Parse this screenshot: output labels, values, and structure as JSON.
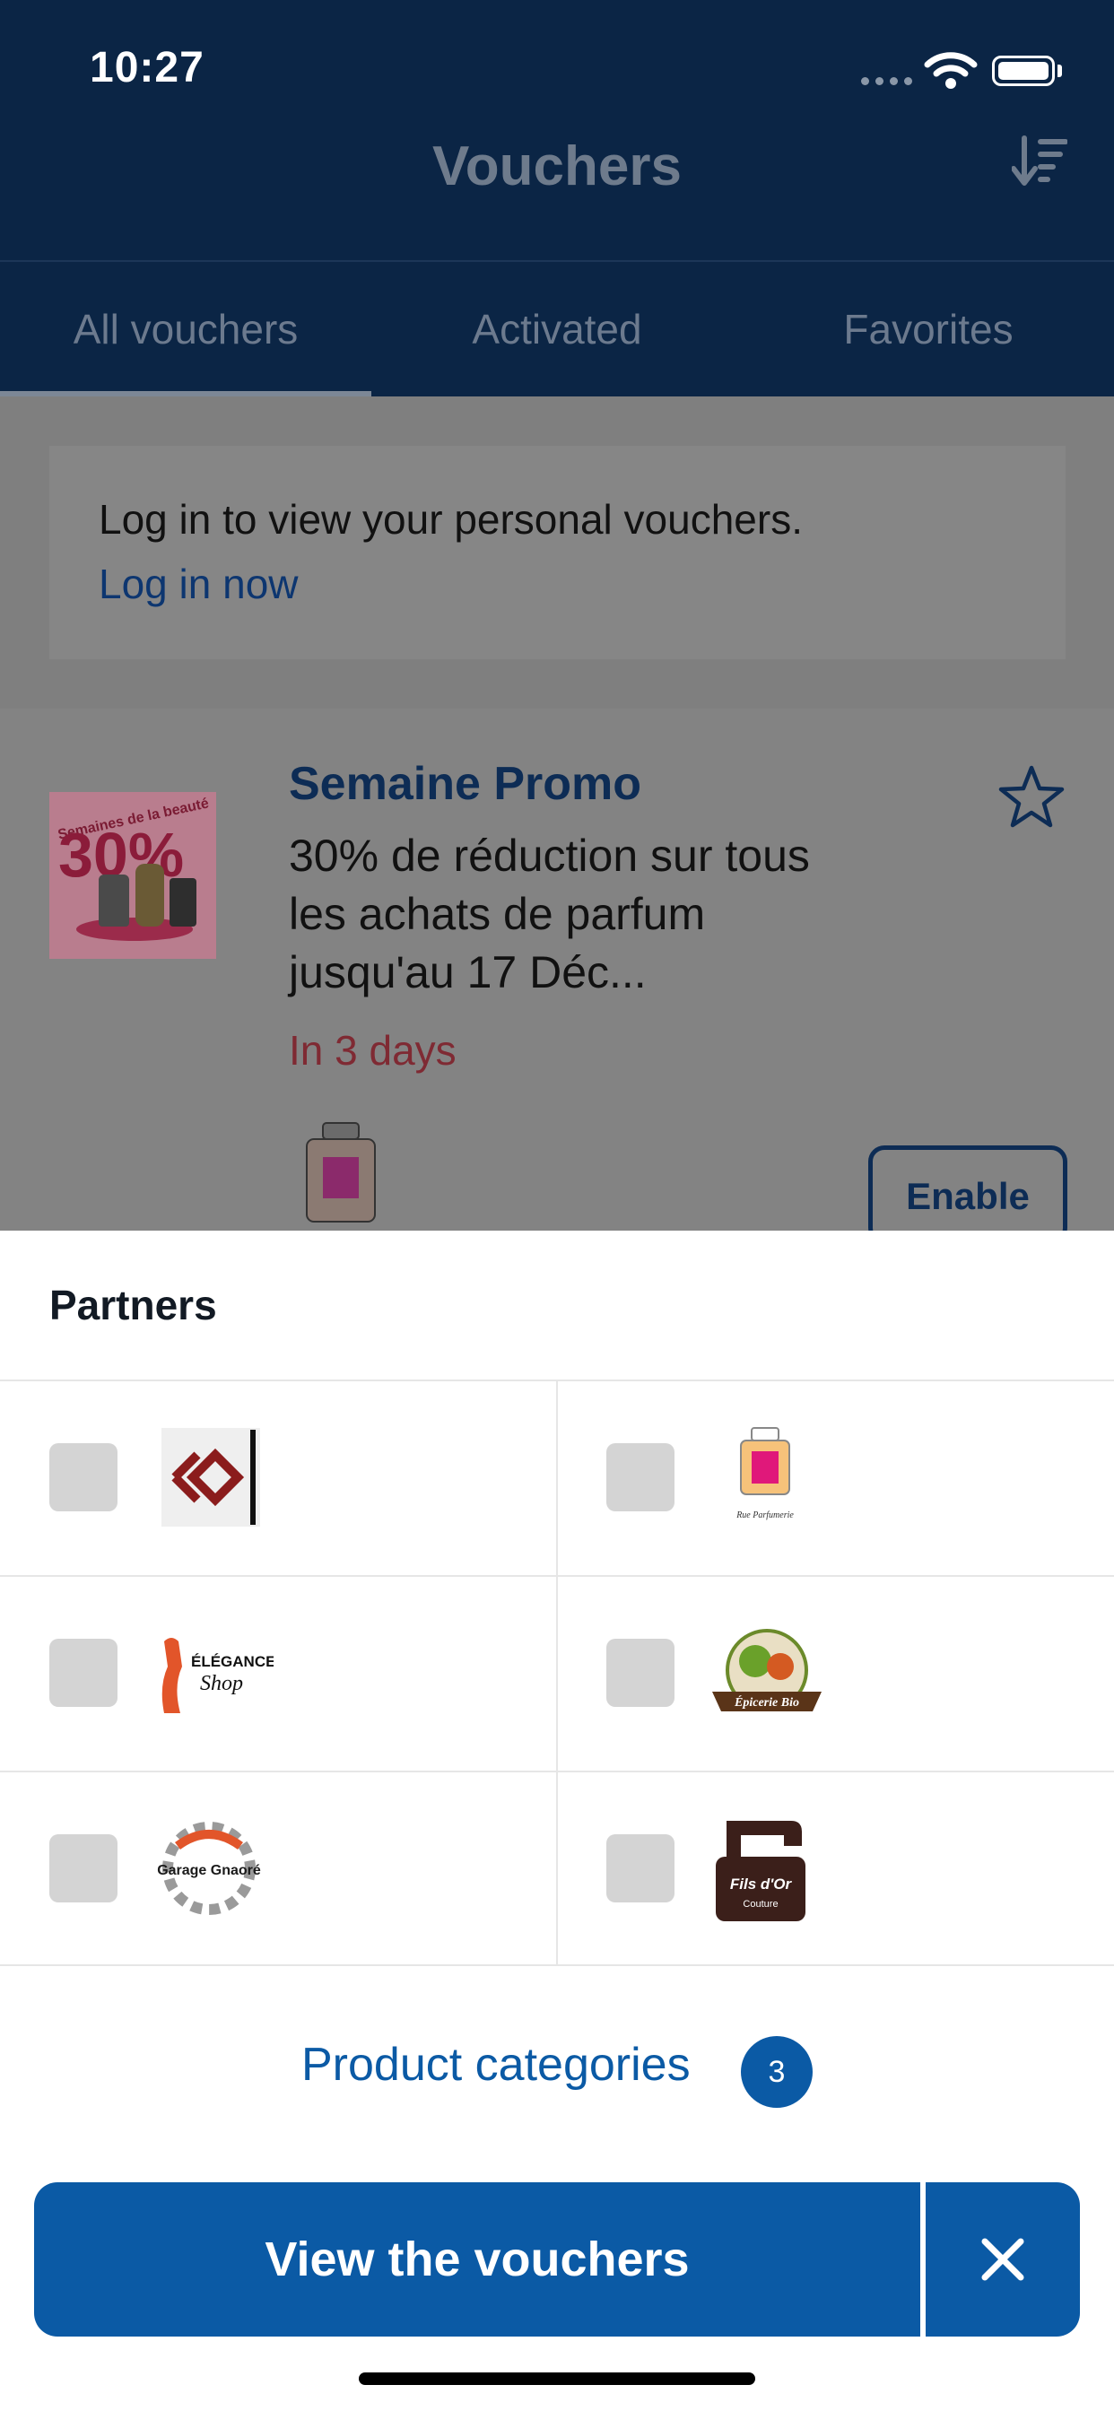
{
  "status_bar": {
    "time": "10:27"
  },
  "header": {
    "title": "Vouchers",
    "sort_icon": "sort-descending-icon"
  },
  "tabs": [
    {
      "label": "All vouchers",
      "active": true
    },
    {
      "label": "Activated",
      "active": false
    },
    {
      "label": "Favorites",
      "active": false
    }
  ],
  "login_banner": {
    "message": "Log in to view your personal vouchers.",
    "link": "Log in now"
  },
  "voucher": {
    "image_text_small": "Semaines de la beauté",
    "image_text_big": "30%",
    "title": "Semaine Promo",
    "description": "30% de réduction sur tous les achats de parfum jusqu'au 17 Déc...",
    "expiry": "In 3 days",
    "favorite_icon": "star-outline-icon",
    "enable_label": "Enable"
  },
  "sheet": {
    "title": "Partners",
    "partners": [
      {
        "logo_icon": "partner-logo-diamond-icon"
      },
      {
        "logo_icon": "partner-logo-perfume-icon",
        "logo_text": "Rue Parfumerie"
      },
      {
        "logo_icon": "partner-logo-elegance-icon",
        "logo_text_1": "ÉLÉGANCE",
        "logo_text_2": "Shop"
      },
      {
        "logo_icon": "partner-logo-epicerie-icon",
        "logo_text": "Épicerie Bio"
      },
      {
        "logo_icon": "partner-logo-garage-icon",
        "logo_text": "Garage Gnaoré"
      },
      {
        "logo_icon": "partner-logo-sewing-icon",
        "logo_text_1": "Fils d'Or",
        "logo_text_2": "Couture"
      }
    ],
    "categories_label": "Product categories",
    "categories_count": "3",
    "view_button": "View the vouchers",
    "close_icon": "close-icon"
  },
  "colors": {
    "header_bg": "#0b2545",
    "primary": "#0b5aa5",
    "overlay": "#7f7f7f",
    "expiry": "#7f2a33"
  }
}
